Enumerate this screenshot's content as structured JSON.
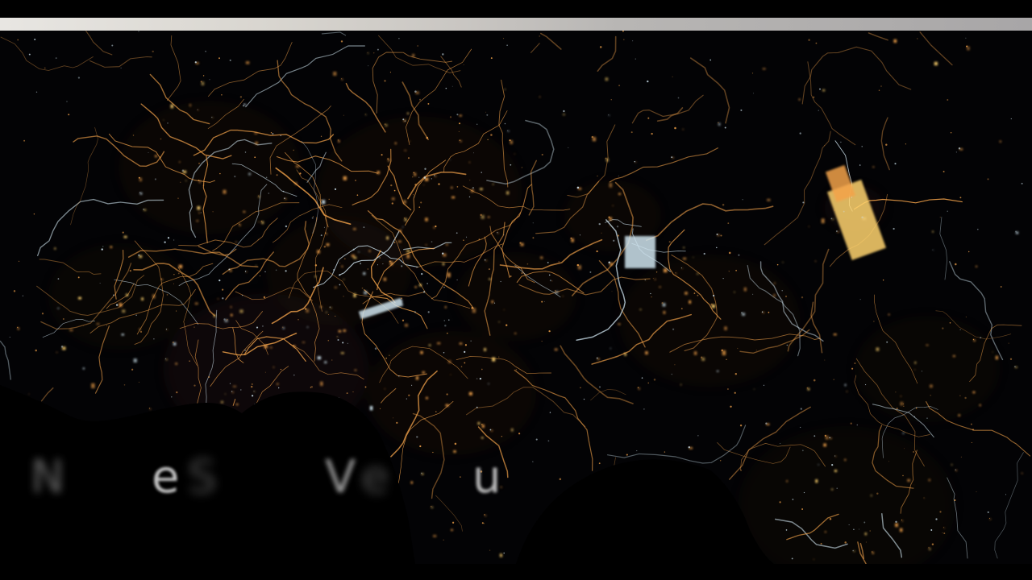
{
  "image": {
    "subject": "night-satellite-city-lights",
    "colors": {
      "background": "#030305",
      "sodium_light": "#f2a24a",
      "bright_light": "#ffd36e",
      "cool_light": "#cfe4ef",
      "sea": "#000000"
    }
  },
  "caption": {
    "fragments": [
      "N",
      "e",
      "S",
      "V",
      "e",
      "u"
    ]
  }
}
